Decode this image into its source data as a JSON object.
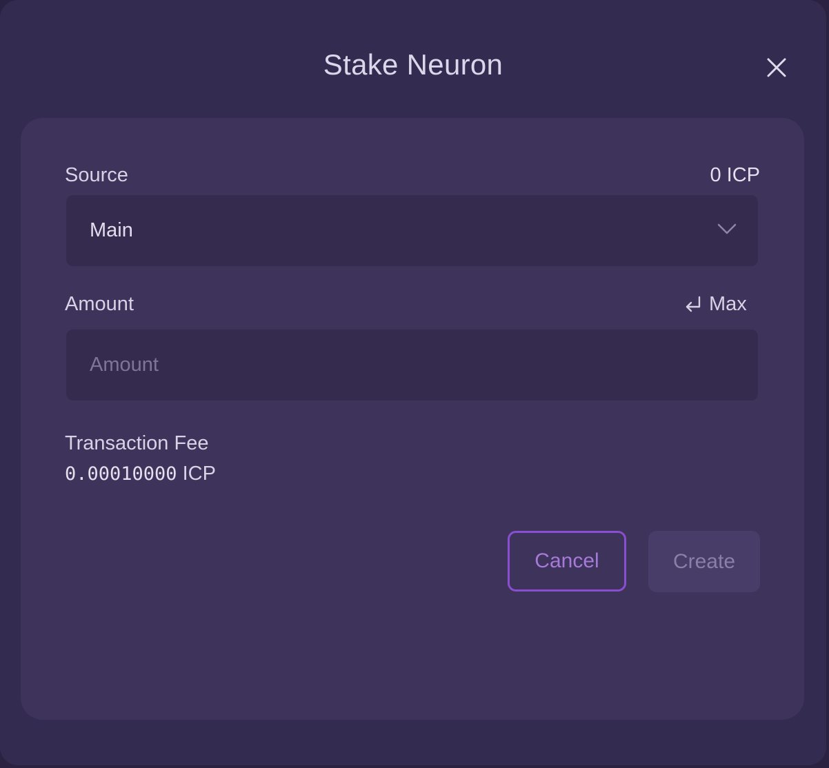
{
  "dialog": {
    "title": "Stake Neuron",
    "close_icon": "close-icon"
  },
  "source": {
    "label": "Source",
    "balance": "0 ICP",
    "selected": "Main",
    "dropdown_icon": "chevron-down-icon"
  },
  "amount": {
    "label": "Amount",
    "max_label": "Max",
    "max_icon": "return-arrow-icon",
    "placeholder": "Amount",
    "value": ""
  },
  "fee": {
    "label": "Transaction Fee",
    "value": "0.00010000",
    "unit": "ICP"
  },
  "actions": {
    "cancel_label": "Cancel",
    "create_label": "Create"
  },
  "colors": {
    "accent": "#8a4fd0",
    "background": "#342b51",
    "card": "#3e335a"
  }
}
